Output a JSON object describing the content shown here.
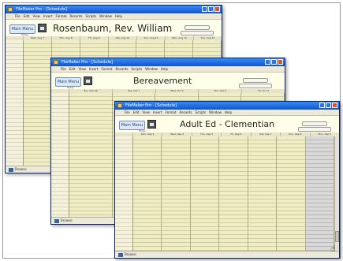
{
  "window1": {
    "title_text": "FileMaker Pro - [Schedule]",
    "menu": [
      "File",
      "Edit",
      "View",
      "Insert",
      "Format",
      "Records",
      "Scripts",
      "Window",
      "Help"
    ],
    "main_menu_label": "Main Menu",
    "heading": "Rosenbaum, Rev. William",
    "today_label": "Today",
    "days": [
      "Wed, Aug 7",
      "Thu, Aug 8",
      "Fri, Aug 9",
      "Sat, Aug 10",
      "Sun, Aug 11",
      "Mon, Aug 12",
      "Tue, Aug 13"
    ],
    "status_text": "Browse"
  },
  "window2": {
    "title_text": "FileMaker Pro - [Schedule]",
    "menu": [
      "File",
      "Edit",
      "View",
      "Insert",
      "Format",
      "Records",
      "Scripts",
      "Window",
      "Help"
    ],
    "main_menu_label": "Main Menu",
    "heading": "Bereavement",
    "today_label": "Today",
    "days": [
      "Tue, Sep 26",
      "Tue, Oct 1",
      "Wed, Oct 2",
      "Thu, Oct 3",
      "Fri, Oct 4"
    ],
    "status_text": "Browse"
  },
  "window3": {
    "title_text": "FileMaker Pro - [Schedule]",
    "menu": [
      "File",
      "Edit",
      "View",
      "Insert",
      "Format",
      "Records",
      "Scripts",
      "Window",
      "Help"
    ],
    "main_menu_label": "Main Menu",
    "heading": "Adult Ed - Clementian",
    "today_label": "Today",
    "days": [
      "Mon, Sep 2",
      "Wed, Sep 4",
      "Thu, Sep 5",
      "Fri, Sep 6",
      "Sat, Sep 7",
      "Sun, Sep 8",
      "Mon, Sep 9"
    ],
    "status_text": "Browse"
  }
}
